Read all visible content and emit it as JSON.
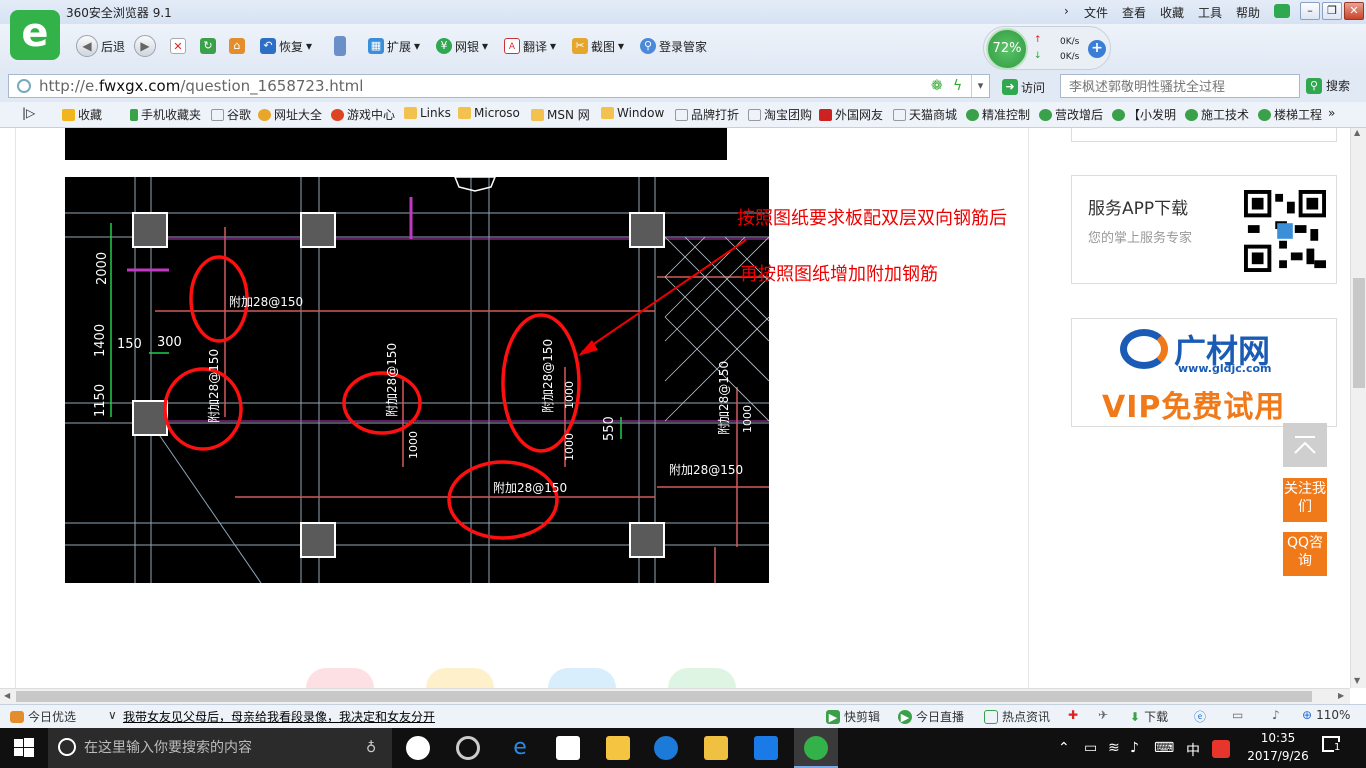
{
  "window": {
    "title": "360安全浏览器 9.1",
    "menu": [
      "文件",
      "查看",
      "收藏",
      "工具",
      "帮助"
    ]
  },
  "toolbar": {
    "back": "后退",
    "restore": "恢复",
    "extensions": "扩展",
    "netbank": "网银",
    "translate": "翻译",
    "screenshot": "截图",
    "login": "登录管家"
  },
  "speed": {
    "percent": "72%",
    "up": "0K/s",
    "down": "0K/s"
  },
  "address": {
    "prefix": "http://e.",
    "host": "fwxgx.com",
    "path": "/question_1658723.html",
    "visit_label": "访问"
  },
  "search": {
    "placeholder": "李枫述郭敬明性骚扰全过程",
    "button": "搜索"
  },
  "bookmarks": [
    "收藏",
    "手机收藏夹",
    "谷歌",
    "网址大全",
    "游戏中心",
    "Links",
    "Microso",
    "MSN 网",
    "Window",
    "品牌打折",
    "淘宝团购",
    "外国网友",
    "天猫商城",
    "精准控制",
    "营改增后",
    "【小发明",
    "施工技术",
    "楼梯工程"
  ],
  "annotation": {
    "line1": "按照图纸要求板配双层双向钢筋后",
    "line2": "再按照图纸增加附加钢筋"
  },
  "cad": {
    "dim_2000": "2000",
    "dim_1400": "1400",
    "dim_1150": "1150",
    "dim_150": "150",
    "dim_300": "300",
    "dim_550": "550",
    "label_a": "附加28@150",
    "label_b": "附加28@150",
    "label_c": "附加28@150",
    "label_d": "附加28@150",
    "label_e": "附加28@150",
    "label_f": "附加28@150",
    "label_g": "附加28@150",
    "label_h": "附加28@150",
    "dim_1000": "1000"
  },
  "sidebar": {
    "app_title": "服务APP下载",
    "app_sub": "您的掌上服务专家",
    "gcw_name": "广材网",
    "gcw_url": "www.gldjc.com",
    "vip": "VIP免费试用",
    "follow": "关注我们",
    "qq": "QQ咨询"
  },
  "status": {
    "today": "今日优选",
    "news": "我带女友见父母后，母亲给我看段录像，我决定和女友分开",
    "clip": "快剪辑",
    "live": "今日直播",
    "hot": "热点资讯",
    "download": "下载",
    "zoom": "110%"
  },
  "taskbar": {
    "search_placeholder": "在这里输入你要搜索的内容",
    "ime": "中",
    "time": "10:35",
    "date": "2017/9/26",
    "notif": "1"
  }
}
